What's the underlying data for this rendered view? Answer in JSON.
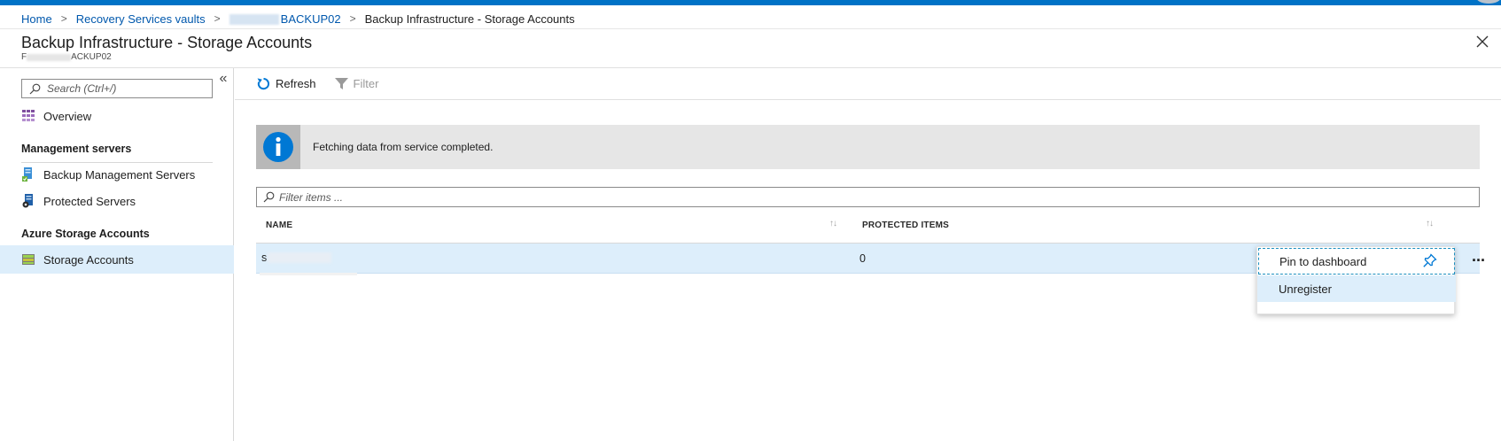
{
  "breadcrumb": {
    "home": "Home",
    "vaults": "Recovery Services vaults",
    "vault_suffix": "BACKUP02",
    "current": "Backup Infrastructure - Storage Accounts"
  },
  "blade": {
    "title": "Backup Infrastructure - Storage Accounts",
    "subtitle_prefix": "F",
    "subtitle_suffix": "ACKUP02"
  },
  "sidebar": {
    "search_placeholder": "Search (Ctrl+/)",
    "collapse_glyph": "«",
    "overview": "Overview",
    "section_management": "Management servers",
    "backup_mgmt_servers": "Backup Management Servers",
    "protected_servers": "Protected Servers",
    "section_storage": "Azure Storage Accounts",
    "storage_accounts": "Storage Accounts"
  },
  "toolbar": {
    "refresh": "Refresh",
    "filter": "Filter"
  },
  "info": {
    "message": "Fetching data from service completed."
  },
  "table": {
    "filter_placeholder": "Filter items ...",
    "col_name": "NAME",
    "col_items": "PROTECTED ITEMS",
    "sort_glyph": "↑↓",
    "rows": [
      {
        "name_prefix": "s",
        "protected_items": "0"
      }
    ]
  },
  "context_menu": {
    "pin": "Pin to dashboard",
    "unregister": "Unregister"
  },
  "row_actions": {
    "ellipsis": "..."
  },
  "colors": {
    "accent": "#0072c6",
    "link": "#0058ad",
    "selected": "#ddeefb",
    "info_icon": "#0078d4"
  },
  "icons": {
    "close": "close-icon",
    "search": "search-icon",
    "refresh": "refresh-icon",
    "filter": "filter-icon",
    "info": "info-icon",
    "pin": "pin-icon"
  }
}
